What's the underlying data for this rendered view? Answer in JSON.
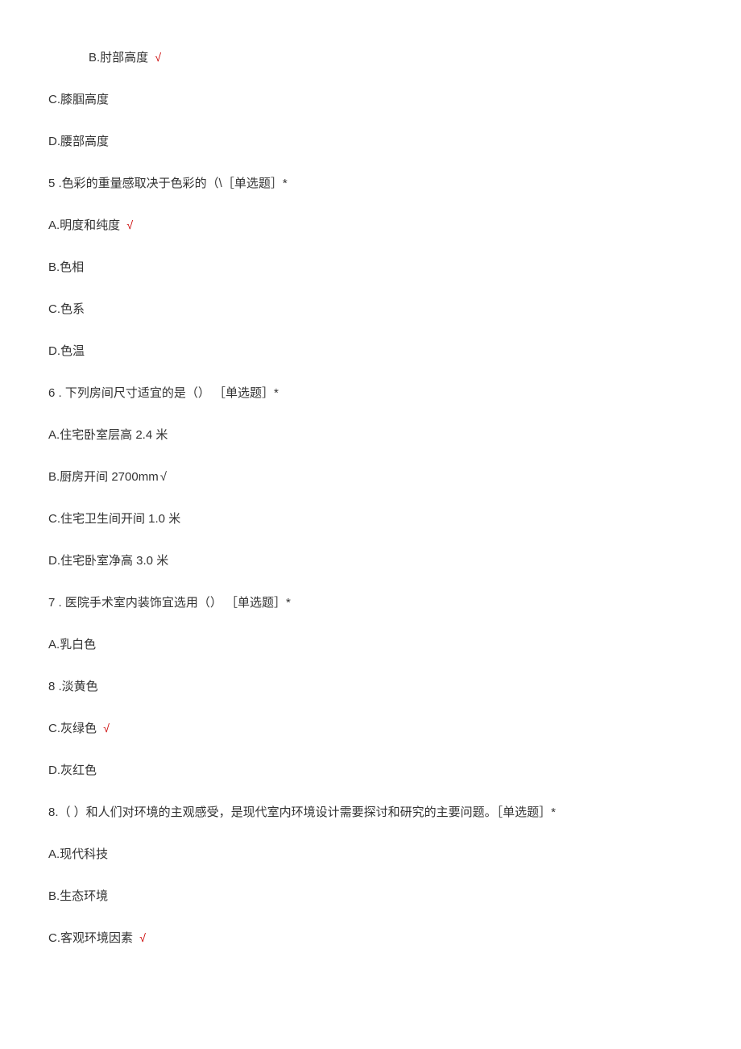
{
  "lines": {
    "opt_b_prev": "B.肘部高度",
    "opt_c_prev": "C.膝腘高度",
    "opt_d_prev": "D.腰部高度",
    "q5": "5   .色彩的重量感取决于色彩的（\\［单选题］*",
    "q5_a": "A.明度和纯度",
    "q5_b": "B.色相",
    "q5_c": "C.色系",
    "q5_d": "D.色温",
    "q6": "6   . 下列房间尺寸适宜的是（） ［单选题］*",
    "q6_a": "A.住宅卧室层高 2.4 米",
    "q6_b": "B.厨房开间 2700mm",
    "q6_c": "C.住宅卫生间开间 1.0 米",
    "q6_d": "D.住宅卧室净高 3.0 米",
    "q7": "7   . 医院手术室内装饰宜选用（） ［单选题］*",
    "q7_a": "A.乳白色",
    "q7_b_num": "8   .淡黄色",
    "q7_c": "C.灰绿色",
    "q7_d": "D.灰红色",
    "q8": "8.（ ）和人们对环境的主观感受，是现代室内环境设计需要探讨和研究的主要问题。［单选题］*",
    "q8_a": "A.现代科技",
    "q8_b": "B.生态环境",
    "q8_c": "C.客观环境因素"
  },
  "check_mark": "√"
}
